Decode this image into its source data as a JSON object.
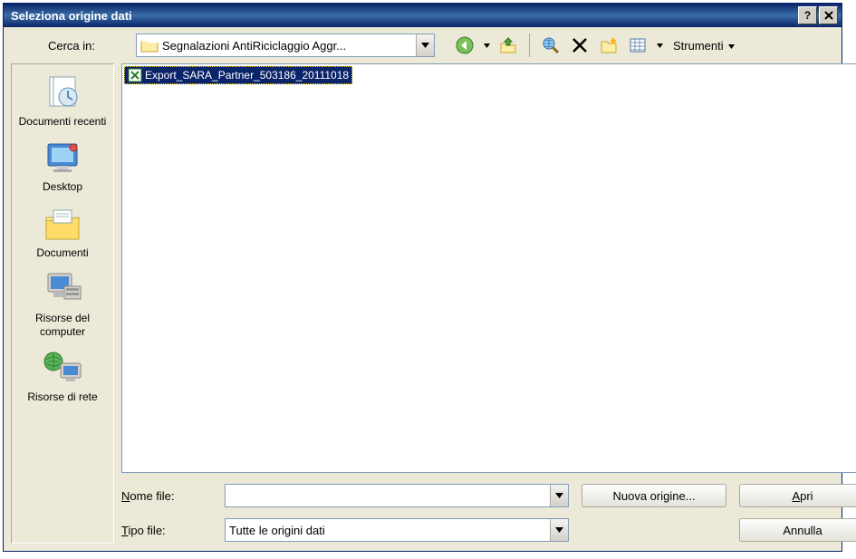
{
  "title": "Seleziona origine dati",
  "lookin_label": "Cerca in:",
  "lookin_value": "Segnalazioni AntiRiciclaggio Aggr...",
  "tools_label": "Strumenti",
  "places": [
    {
      "label": "Documenti recenti"
    },
    {
      "label": "Desktop"
    },
    {
      "label": "Documenti"
    },
    {
      "label": "Risorse del computer"
    },
    {
      "label": "Risorse di rete"
    }
  ],
  "file_selected": "Export_SARA_Partner_503186_20111018",
  "filename_label_pre": "N",
  "filename_label_post": "ome file:",
  "filetype_label_pre": "T",
  "filetype_label_post": "ipo file:",
  "filename_value": "",
  "filetype_value": "Tutte le origini dati",
  "btn_newsource": "Nuova origine...",
  "btn_open_ul": "A",
  "btn_open_rest": "pri",
  "btn_cancel": "Annulla"
}
